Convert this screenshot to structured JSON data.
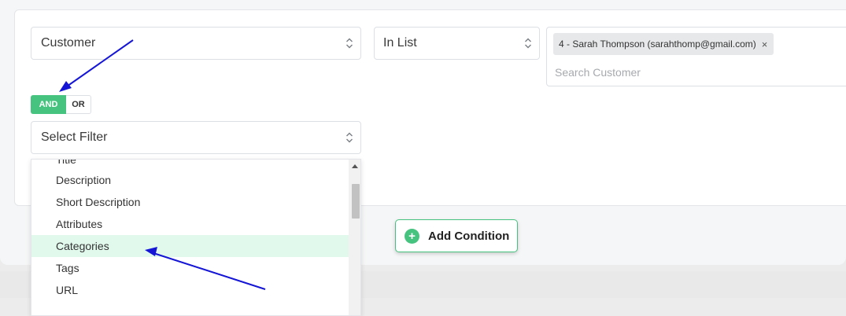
{
  "condition": {
    "field_value": "Customer",
    "operator_value": "In List",
    "selected_tags": [
      {
        "label": "4 - Sarah Thompson (sarahthomp@gmail.com)",
        "remove_symbol": "×"
      }
    ],
    "search_placeholder": "Search Customer"
  },
  "logic_toggle": {
    "and_label": "AND",
    "or_label": "OR",
    "selected": "AND"
  },
  "filter_select": {
    "placeholder": "Select Filter",
    "options": [
      "Title",
      "Description",
      "Short Description",
      "Attributes",
      "Categories",
      "Tags",
      "URL"
    ],
    "highlighted": "Categories"
  },
  "add_condition": {
    "label": "Add Condition",
    "icon": "plus-circle-icon"
  },
  "colors": {
    "accent_green": "#47c380",
    "highlight_row": "#e1f9ec",
    "annotation_arrow": "#1515d6"
  }
}
